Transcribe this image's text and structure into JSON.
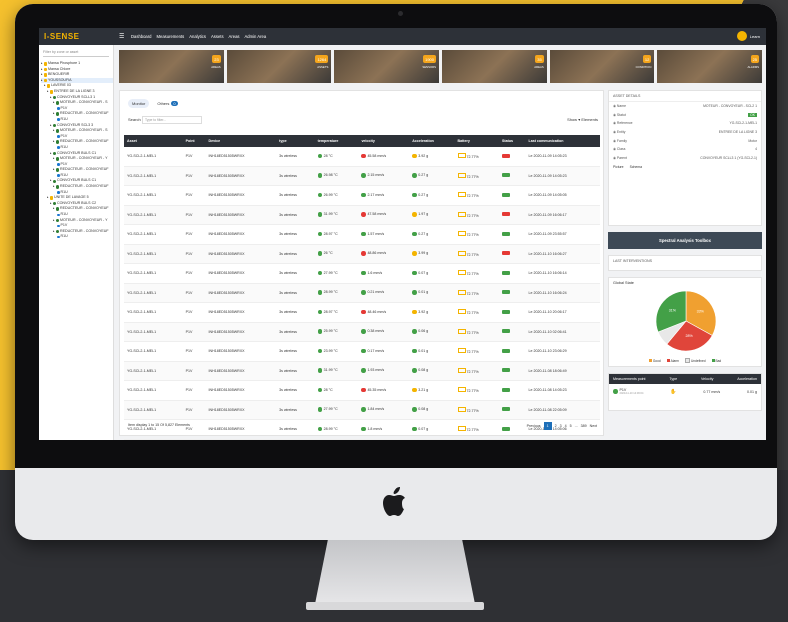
{
  "colors": {
    "accent": "#f4b400",
    "topbar": "#2d3138",
    "primary": "#1e6fb8",
    "ok": "#43a047",
    "alert": "#e53935",
    "warn": "#f4b400"
  },
  "topbar": {
    "brand": "I-SENSE",
    "nav": [
      "Dashboard",
      "Measurements",
      "Analytics",
      "Assets",
      "Areas",
      "Admin Area"
    ],
    "user": "Learn"
  },
  "sidebar": {
    "search_placeholder": "Filter by zone or asset",
    "tree": [
      {
        "label": "Mansa Phosphore 1",
        "icon": "folder-icon",
        "indent": 0
      },
      {
        "label": "Mansa Chlore",
        "icon": "folder-icon",
        "indent": 0
      },
      {
        "label": "BENGUERIR",
        "icon": "folder-icon",
        "indent": 0
      },
      {
        "label": "YOUSSOUFIA",
        "icon": "folder-icon",
        "indent": 0,
        "selected": true
      },
      {
        "label": "LAVERIE 03",
        "icon": "folder-icon",
        "indent": 1
      },
      {
        "label": "ENTREE DE LA LIGNE 3",
        "icon": "folder-icon",
        "indent": 2
      },
      {
        "label": "CONVOYEUR SCLL3 1",
        "icon": "gear-icon",
        "indent": 3
      },
      {
        "label": "MOTEUR - CONVOYEUR - S",
        "icon": "gear-icon",
        "indent": 4
      },
      {
        "label": "P1V",
        "icon": "dot-icon",
        "indent": 5
      },
      {
        "label": "REDUCTEUR - CONVOYEUF",
        "icon": "gear-icon",
        "indent": 4
      },
      {
        "label": "R1U",
        "icon": "dot-icon",
        "indent": 5
      },
      {
        "label": "CONVOYEUR SCL3 3",
        "icon": "gear-icon",
        "indent": 3
      },
      {
        "label": "MOTEUR - CONVOYEUR - S",
        "icon": "gear-icon",
        "indent": 4
      },
      {
        "label": "P1V",
        "icon": "dot-icon",
        "indent": 5
      },
      {
        "label": "REDUCTEUR - CONVOYEUF",
        "icon": "gear-icon",
        "indent": 4
      },
      {
        "label": "R1U",
        "icon": "dot-icon",
        "indent": 5
      },
      {
        "label": "CONVOYEUR BULS C1",
        "icon": "gear-icon",
        "indent": 3
      },
      {
        "label": "MOTEUR - CONVOYEUR - Y",
        "icon": "gear-icon",
        "indent": 4
      },
      {
        "label": "P1V",
        "icon": "dot-icon",
        "indent": 5
      },
      {
        "label": "REDUCTEUR - CONVOYEUF",
        "icon": "gear-icon",
        "indent": 4
      },
      {
        "label": "R1U",
        "icon": "dot-icon",
        "indent": 5
      },
      {
        "label": "CONVOYEUR BULS C1",
        "icon": "gear-icon",
        "indent": 3
      },
      {
        "label": "REDUCTEUR - CONVOYEUF",
        "icon": "gear-icon",
        "indent": 4
      },
      {
        "label": "R1U",
        "icon": "dot-icon",
        "indent": 5
      },
      {
        "label": "UNITE DE LAVAGE 5",
        "icon": "folder-icon",
        "indent": 2
      },
      {
        "label": "CONVOYEUR BULS C2",
        "icon": "gear-icon",
        "indent": 3
      },
      {
        "label": "REDUCTEUR - CONVOYEUF",
        "icon": "gear-icon",
        "indent": 4
      },
      {
        "label": "R1U",
        "icon": "dot-icon",
        "indent": 5
      },
      {
        "label": "MOTEUR - CONVOYEUR - Y",
        "icon": "gear-icon",
        "indent": 4
      },
      {
        "label": "P1V",
        "icon": "dot-icon",
        "indent": 5
      },
      {
        "label": "REDUCTEUR - CONVOYEUF",
        "icon": "gear-icon",
        "indent": 4
      },
      {
        "label": "R1U",
        "icon": "dot-icon",
        "indent": 5
      }
    ]
  },
  "banner": [
    {
      "value": "23",
      "label": "AREAS"
    },
    {
      "value": "1264",
      "label": "ASSETS"
    },
    {
      "value": "1900",
      "label": "SENSORS"
    },
    {
      "value": "35",
      "label": "AREAS"
    },
    {
      "value": "12",
      "label": "CONDITION"
    },
    {
      "value": "25",
      "label": "ALARMS"
    }
  ],
  "main": {
    "tabs": [
      {
        "label": "Monitor",
        "count": ""
      },
      {
        "label": "Others",
        "count": "0"
      }
    ],
    "search_label": "Search",
    "search_placeholder": "Type to filter...",
    "show_label": "Show",
    "show_suffix": "Elements",
    "columns": [
      "Asset",
      "Point",
      "Device",
      "type",
      "temperature",
      "velocity",
      "Acceleration",
      "Battery",
      "Status",
      "Last communication"
    ],
    "rows": [
      {
        "asset": "YG-SCL2-1-MEL1",
        "point": "P1V",
        "device": "INH18ED51505WRXX",
        "type": "3s wireless",
        "temp": "28 °C",
        "temp_c": "g",
        "vel": "45.58 mm/s",
        "vel_c": "r",
        "acc": "3.92 g",
        "acc_c": "y",
        "bat": "72.77%",
        "status_c": "r",
        "last": "Le 2020-11-09 14:05:23"
      },
      {
        "asset": "YG-SCL2-1-MEL1",
        "point": "P1V",
        "device": "INH18ED51505WRXX",
        "type": "3s wireless",
        "temp": "26.98 °C",
        "temp_c": "g",
        "vel": "2.15 mm/s",
        "vel_c": "g",
        "acc": "0.27 g",
        "acc_c": "g",
        "bat": "72.77%",
        "status_c": "g",
        "last": "Le 2020-11-09 14:05:23"
      },
      {
        "asset": "YG-SCL2-1-MEL1",
        "point": "P1V",
        "device": "INH18ED51505WRXX",
        "type": "3s wireless",
        "temp": "26.99 °C",
        "temp_c": "g",
        "vel": "2.17 mm/s",
        "vel_c": "g",
        "acc": "0.27 g",
        "acc_c": "g",
        "bat": "72.77%",
        "status_c": "g",
        "last": "Le 2020-11-09 14:05:05"
      },
      {
        "asset": "YG-SCL2-1-MEL1",
        "point": "P1V",
        "device": "INH18ED51505WRXX",
        "type": "3s wireless",
        "temp": "31.99 °C",
        "temp_c": "g",
        "vel": "47.58 mm/s",
        "vel_c": "r",
        "acc": "1.97 g",
        "acc_c": "y",
        "bat": "72.77%",
        "status_c": "r",
        "last": "Le 2020-11-09 16:06:17"
      },
      {
        "asset": "YG-SCL2-1-MEL1",
        "point": "P1V",
        "device": "INH18ED51505WRXX",
        "type": "3s wireless",
        "temp": "28.97 °C",
        "temp_c": "g",
        "vel": "1.57 mm/s",
        "vel_c": "g",
        "acc": "0.27 g",
        "acc_c": "g",
        "bat": "72.77%",
        "status_c": "g",
        "last": "Le 2020-11-09 23:55:57"
      },
      {
        "asset": "YG-SCL2-1-MEL1",
        "point": "P1V",
        "device": "INH18ED51505WRXX",
        "type": "3s wireless",
        "temp": "26 °C",
        "temp_c": "g",
        "vel": "48.86 mm/s",
        "vel_c": "r",
        "acc": "3.99 g",
        "acc_c": "y",
        "bat": "72.77%",
        "status_c": "r",
        "last": "Le 2020-11-10 16:06:27"
      },
      {
        "asset": "YG-SCL2-1-MEL1",
        "point": "P1V",
        "device": "INH18ED51505WRXX",
        "type": "3s wireless",
        "temp": "27.99 °C",
        "temp_c": "g",
        "vel": "1.6 mm/s",
        "vel_c": "g",
        "acc": "0.07 g",
        "acc_c": "g",
        "bat": "72.77%",
        "status_c": "g",
        "last": "Le 2020-11-10 16:06:14"
      },
      {
        "asset": "YG-SCL2-1-MEL1",
        "point": "P1V",
        "device": "INH18ED51505WRXX",
        "type": "3s wireless",
        "temp": "28.99 °C",
        "temp_c": "g",
        "vel": "0.21 mm/s",
        "vel_c": "g",
        "acc": "0.01 g",
        "acc_c": "g",
        "bat": "72.77%",
        "status_c": "g",
        "last": "Le 2020-11-10 16:06:24"
      },
      {
        "asset": "YG-SCL2-1-MEL1",
        "point": "P1V",
        "device": "INH18ED51505WRXX",
        "type": "3s wireless",
        "temp": "28.97 °C",
        "temp_c": "g",
        "vel": "48.46 mm/s",
        "vel_c": "r",
        "acc": "3.92 g",
        "acc_c": "y",
        "bat": "72.77%",
        "status_c": "g",
        "last": "Le 2020-11-10 20:06:17"
      },
      {
        "asset": "YG-SCL2-1-MEL1",
        "point": "P1V",
        "device": "INH18ED51505WRXX",
        "type": "3s wireless",
        "temp": "25.99 °C",
        "temp_c": "g",
        "vel": "0.38 mm/s",
        "vel_c": "g",
        "acc": "0.06 g",
        "acc_c": "g",
        "bat": "72.77%",
        "status_c": "g",
        "last": "Le 2020-11-10 02:06:41"
      },
      {
        "asset": "YG-SCL2-1-MEL1",
        "point": "P1V",
        "device": "INH18ED51505WRXX",
        "type": "3s wireless",
        "temp": "23.99 °C",
        "temp_c": "g",
        "vel": "0.17 mm/s",
        "vel_c": "g",
        "acc": "0.01 g",
        "acc_c": "g",
        "bat": "72.77%",
        "status_c": "g",
        "last": "Le 2020-11-10 23:06:29"
      },
      {
        "asset": "YG-SCL2-1-MEL1",
        "point": "P1V",
        "device": "INH18ED51505WRXX",
        "type": "3s wireless",
        "temp": "31.99 °C",
        "temp_c": "g",
        "vel": "1.93 mm/s",
        "vel_c": "g",
        "acc": "0.08 g",
        "acc_c": "g",
        "bat": "72.77%",
        "status_c": "g",
        "last": "Le 2020-11-08 18:06:49"
      },
      {
        "asset": "YG-SCL2-1-MEL1",
        "point": "P1V",
        "device": "INH18ED51505WRXX",
        "type": "3s wireless",
        "temp": "28 °C",
        "temp_c": "g",
        "vel": "45.35 mm/s",
        "vel_c": "r",
        "acc": "3.21 g",
        "acc_c": "y",
        "bat": "72.77%",
        "status_c": "g",
        "last": "Le 2020-11-08 14:05:23"
      },
      {
        "asset": "YG-SCL2-1-MEL1",
        "point": "P1V",
        "device": "INH18ED51505WRXX",
        "type": "3s wireless",
        "temp": "27.99 °C",
        "temp_c": "g",
        "vel": "1.84 mm/s",
        "vel_c": "g",
        "acc": "0.08 g",
        "acc_c": "g",
        "bat": "72.77%",
        "status_c": "g",
        "last": "Le 2020-11-08 22:05:09"
      },
      {
        "asset": "YG-SCL2-1-MEL1",
        "point": "P1V",
        "device": "INH18ED51505WRXX",
        "type": "3s wireless",
        "temp": "28.99 °C",
        "temp_c": "g",
        "vel": "1.8 mm/s",
        "vel_c": "g",
        "acc": "0.07 g",
        "acc_c": "g",
        "bat": "72.77%",
        "status_c": "g",
        "last": "Le 2020-11-08 14:05:06"
      }
    ],
    "footer": "Item display 1 to 15 Of 5,827 Elements",
    "pager": [
      "Previous",
      "1",
      "2",
      "3",
      "4",
      "5",
      "...",
      "389",
      "Next"
    ]
  },
  "details": {
    "title": "ASSET DETAILS",
    "rows": [
      {
        "icon": "gear-icon",
        "k": "Name",
        "v": "MOTEUR - CONVOYEUR - SCL2 1"
      },
      {
        "icon": "status-icon",
        "k": "Statut",
        "v": "OK"
      },
      {
        "icon": "tag-icon",
        "k": "Reference",
        "v": "YG-SCL2-1-MEL1"
      },
      {
        "icon": "building-icon",
        "k": "Entity",
        "v": "ENTREE DE LA LIGNE 3"
      },
      {
        "icon": "family-icon",
        "k": "Family",
        "v": "Motor"
      },
      {
        "icon": "class-icon",
        "k": "Class",
        "v": "4"
      },
      {
        "icon": "parent-icon",
        "k": "Parent",
        "v": "CONVOYEUR SCLL3 1 (YG-SCL2-1)"
      }
    ],
    "links": [
      "Picture",
      "Schema"
    ],
    "spectral": "Spectral Analysis Toolbox",
    "interventions": "LAST INTERVENTIONS",
    "global_state": "Global State",
    "legend": [
      "Good",
      "Alarm",
      "Undefined",
      "Bad"
    ],
    "mp_cols": [
      "Measurements point",
      "Type",
      "Velocity",
      "Acceleration"
    ],
    "mp_row": {
      "point": "P1V",
      "date": "2020-11-10 14:06:04",
      "velocity": "0.77 mm/s",
      "acceleration": "0.01 g"
    }
  },
  "chart_data": {
    "type": "pie",
    "categories": [
      "Good",
      "Alarm",
      "Undefined",
      "Bad"
    ],
    "values": [
      33,
      28,
      8,
      31
    ],
    "colors": [
      "#f0a030",
      "#e0453a",
      "#e8e8e8",
      "#43a047"
    ],
    "labels": [
      "33%",
      "28%",
      "",
      "31%"
    ],
    "title": "Global State"
  }
}
